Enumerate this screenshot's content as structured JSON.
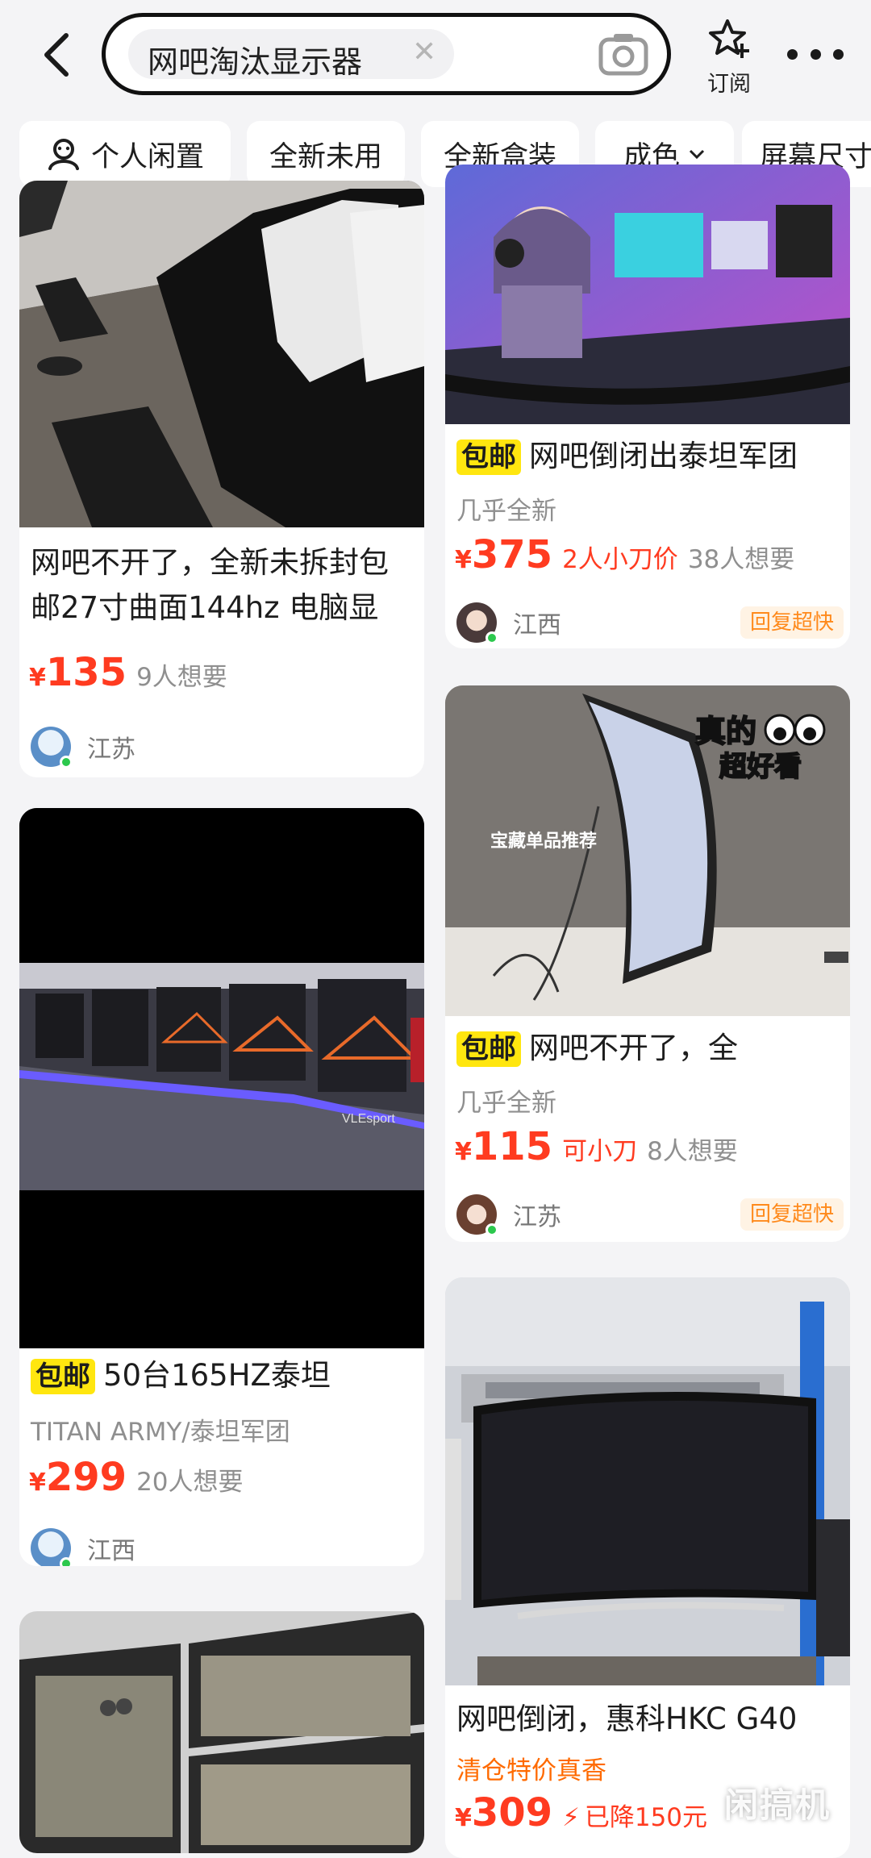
{
  "header": {
    "query": "网吧淘汰显示器",
    "clear_icon": "close-icon",
    "subscribe_label": "订阅"
  },
  "filters": [
    {
      "label": "个人闲置",
      "icon": "person-icon"
    },
    {
      "label": "全新未用"
    },
    {
      "label": "全新盒装"
    },
    {
      "label": "成色",
      "icon": "chevron-down-icon"
    },
    {
      "label": "屏幕尺寸"
    }
  ],
  "colors": {
    "price": "#ff3b20",
    "baoyou_bg": "#ffe60f",
    "badge_text": "#ff8a1c",
    "page_bg": "#f4f4f6"
  },
  "left": [
    {
      "title": "网吧不开了，全新未拆封包邮27寸曲面144hz 电脑显",
      "currency": "¥",
      "price": "135",
      "want": "9人想要",
      "region": "江苏"
    },
    {
      "baoyou": "包邮",
      "title": "50台165HZ泰坦",
      "brand": "TITAN ARMY/泰坦军团",
      "currency": "¥",
      "price": "299",
      "want": "20人想要",
      "region": "江西",
      "image_text": "VLEsport"
    }
  ],
  "right": [
    {
      "baoyou": "包邮",
      "title": "网吧倒闭出泰坦军团",
      "condition": "几乎全新",
      "currency": "¥",
      "price": "375",
      "tag": "2人小刀价",
      "want": "38人想要",
      "region": "江西",
      "badge": "回复超快"
    },
    {
      "baoyou": "包邮",
      "title": "网吧不开了，全",
      "condition": "几乎全新",
      "currency": "¥",
      "price": "115",
      "tag": "可小刀",
      "want": "8人想要",
      "region": "江苏",
      "badge": "回复超快",
      "image_text_1": "真的",
      "image_text_2": "超好看",
      "image_text_3": "宝藏单品推荐"
    },
    {
      "title": "网吧倒闭，惠科HKC G40",
      "subtitle": "清仓特价真香",
      "currency": "¥",
      "price": "309",
      "discount": "已降150元"
    }
  ],
  "watermark": "闲搞机"
}
